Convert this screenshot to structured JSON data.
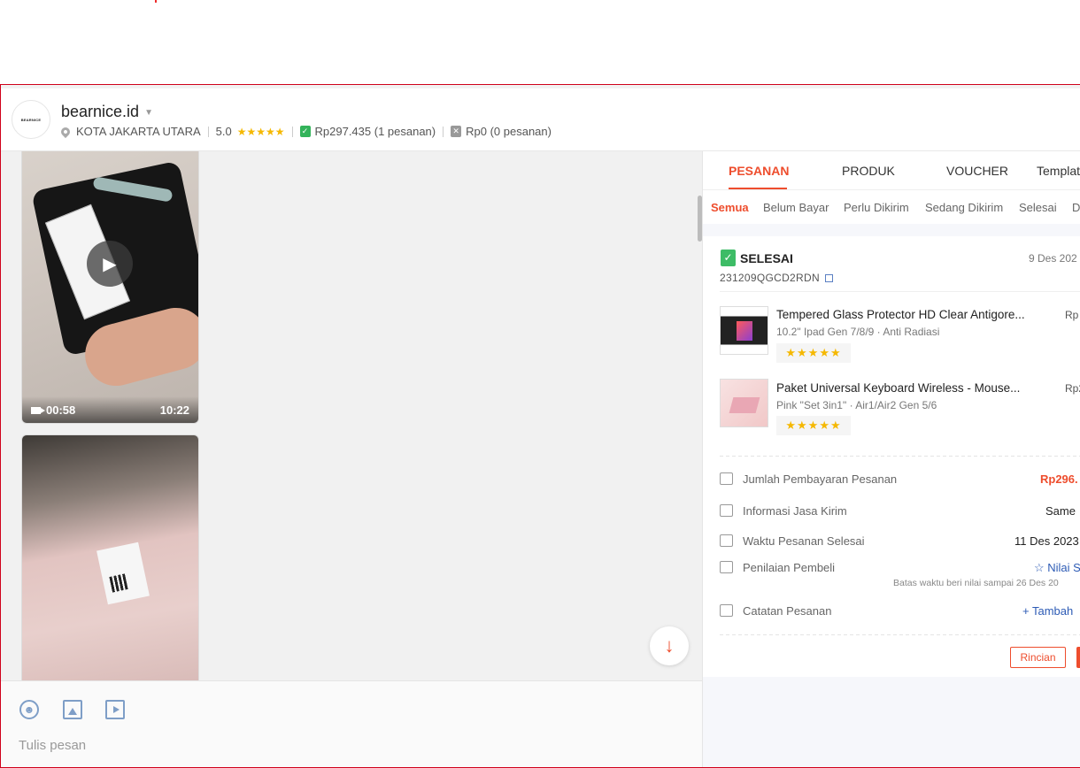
{
  "shop": {
    "name": "bearnice.id",
    "avatar_text": "BEARNICE",
    "location": "KOTA JAKARTA UTARA",
    "rating": "5.0",
    "stars": "★★★★★",
    "paid_total": "Rp297.435 (1 pesanan)",
    "cancelled_total": "Rp0 (0 pesanan)"
  },
  "chat": {
    "videos": [
      {
        "duration": "00:58",
        "time": "10:22"
      },
      {
        "duration": "",
        "time": ""
      }
    ],
    "composer_placeholder": "Tulis pesan"
  },
  "panel": {
    "tabs": [
      "PESANAN",
      "PRODUK",
      "VOUCHER",
      "Templat"
    ],
    "subtabs": [
      "Semua",
      "Belum Bayar",
      "Perlu Dikirim",
      "Sedang Dikirim",
      "Selesai",
      "D"
    ],
    "order": {
      "status": "SELESAI",
      "date": "9 Des 202",
      "id": "231209QGCD2RDN",
      "items": [
        {
          "name": "Tempered Glass Protector HD Clear Antigore...",
          "variant": "10.2\" Ipad Gen 7/8/9 · Anti Radiasi",
          "price": "Rp",
          "stars": "★★★★★"
        },
        {
          "name": "Paket Universal Keyboard Wireless - Mouse...",
          "variant": "Pink \"Set 3in1\" · Air1/Air2 Gen 5/6",
          "price": "Rp2",
          "stars": "★★★★★"
        }
      ],
      "info": {
        "payment_label": "Jumlah Pembayaran Pesanan",
        "payment_value": "Rp296.",
        "shipping_label": "Informasi Jasa Kirim",
        "shipping_value": "Same",
        "completed_label": "Waktu Pesanan Selesai",
        "completed_value": "11 Des 2023",
        "review_label": "Penilaian Pembeli",
        "review_value": "☆ Nilai S",
        "review_note": "Batas waktu beri nilai sampai 26 Des 20",
        "notes_label": "Catatan Pesanan",
        "notes_value": "+ Tambah"
      },
      "details_button": "Rincian"
    }
  },
  "colors": {
    "accent": "#ee4d2d",
    "success": "#3dbc66",
    "link": "#2d5bb5",
    "star": "#f5b800"
  }
}
